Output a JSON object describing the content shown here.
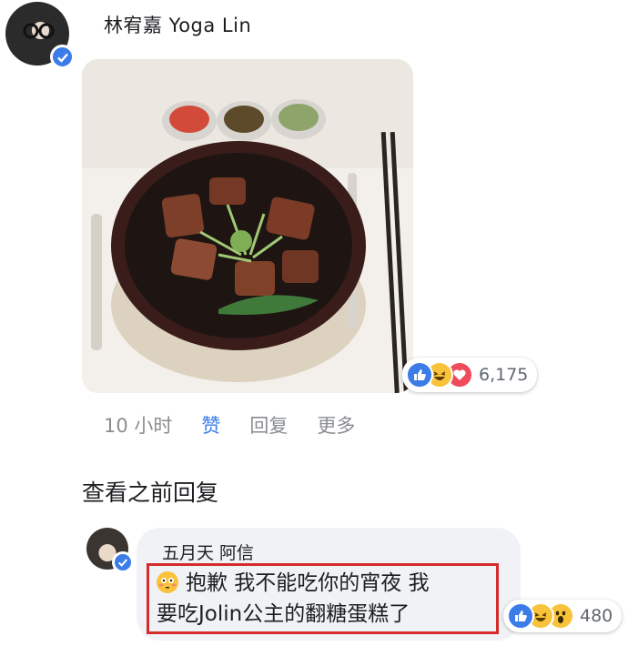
{
  "post": {
    "author": "林宥嘉 Yoga Lin",
    "reactions": {
      "icons": [
        "like-icon",
        "haha-icon",
        "love-icon"
      ],
      "count": "6,175"
    },
    "actions": {
      "time": "10 小时",
      "like": "赞",
      "reply": "回复",
      "more": "更多"
    }
  },
  "view_previous": "查看之前回复",
  "reply": {
    "author": "五月天 阿信",
    "emoji": "flushed-face-icon",
    "text_line1": "抱歉 我不能吃你的宵夜 我",
    "text_line2": "要吃Jolin公主的翻糖蛋糕了",
    "reactions": {
      "icons": [
        "like-icon",
        "haha-icon",
        "wow-icon"
      ],
      "count": "480"
    }
  },
  "colors": {
    "facebook_blue": "#3b7ce8",
    "highlight_red": "#d52b2b",
    "bubble_gray": "#f0f2f5"
  }
}
